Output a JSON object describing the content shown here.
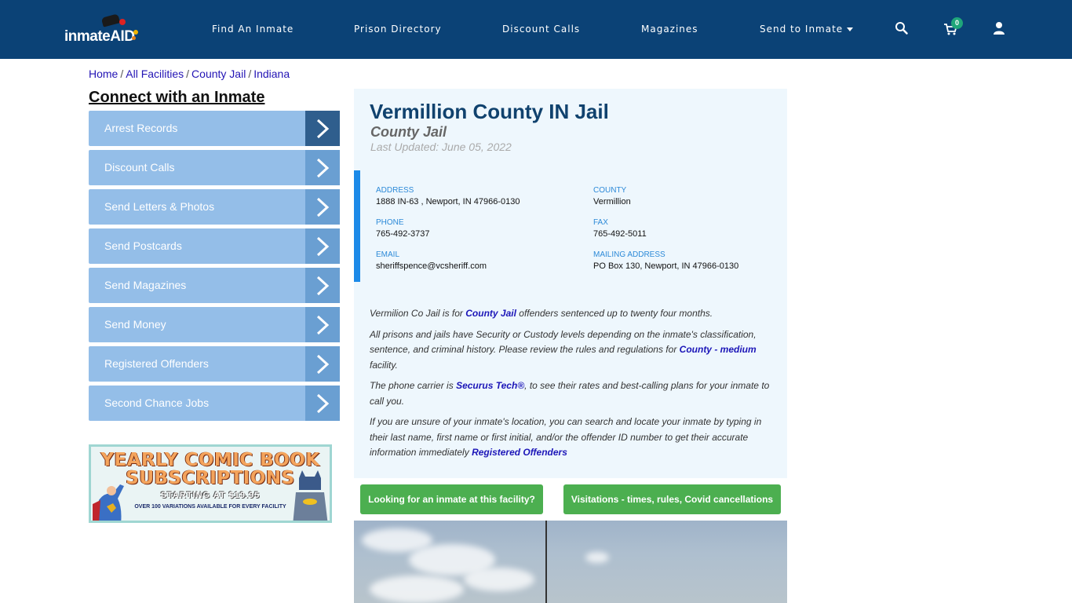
{
  "navbar": {
    "logo_text": "inmateAID",
    "links": [
      {
        "label": "Find An Inmate"
      },
      {
        "label": "Prison Directory"
      },
      {
        "label": "Discount Calls"
      },
      {
        "label": "Magazines"
      },
      {
        "label": "Send to Inmate",
        "has_dropdown": true
      }
    ],
    "icons": [
      "search-icon",
      "cart-icon",
      "user-icon"
    ],
    "cart_count": "0",
    "colors": {
      "background": "#0b4276",
      "badge": "#1fa67a"
    }
  },
  "breadcrumb": {
    "items": [
      "Home",
      "All Facilities",
      "County Jail",
      "Indiana"
    ],
    "separator": "/"
  },
  "sidebar": {
    "title": "Connect with an Inmate",
    "items": [
      {
        "label": "Arrest Records",
        "active": true
      },
      {
        "label": "Discount Calls"
      },
      {
        "label": "Send Letters & Photos"
      },
      {
        "label": "Send Postcards"
      },
      {
        "label": "Send Magazines"
      },
      {
        "label": "Send Money"
      },
      {
        "label": "Registered Offenders"
      },
      {
        "label": "Second Chance Jobs"
      }
    ],
    "ad": {
      "line1": "YEARLY COMIC BOOK",
      "line2": "SUBSCRIPTIONS",
      "line3": "STARTING AT $19.95",
      "line4": "OVER 100 VARIATIONS AVAILABLE FOR EVERY FACILITY"
    }
  },
  "facility": {
    "title": "Vermillion County IN Jail",
    "type": "County Jail",
    "last_updated": "Last Updated: June 05, 2022",
    "fields": {
      "address": {
        "label": "ADDRESS",
        "value": "1888 IN-63 , Newport, IN 47966-0130"
      },
      "county": {
        "label": "COUNTY",
        "value": "Vermillion"
      },
      "phone": {
        "label": "PHONE",
        "value": "765-492-3737"
      },
      "fax": {
        "label": "FAX",
        "value": "765-492-5011"
      },
      "email": {
        "label": "EMAIL",
        "value": "sheriffspence@vcsheriff.com"
      },
      "mailing": {
        "label": "MAILING ADDRESS",
        "value": "PO Box 130, Newport, IN 47966-0130"
      }
    },
    "description": {
      "p1_before": "Vermilion Co Jail is for ",
      "p1_link": "County Jail",
      "p1_after": " offenders sentenced up to twenty four months.",
      "p2_before": "All prisons and jails have Security or Custody levels depending on the inmate's classification, sentence, and criminal history. Please review the rules and regulations for ",
      "p2_link": "County - medium",
      "p2_after": " facility.",
      "p3_before": "The phone carrier is ",
      "p3_link": "Securus Tech®",
      "p3_after": ", to see their rates and best-calling plans for your inmate to call you.",
      "p4_before": "If you are unsure of your inmate's location, you can search and locate your inmate by typing in their last name, first name or first initial, and/or the offender ID number to get their accurate information immediately ",
      "p4_link": "Registered Offenders"
    },
    "buttons": {
      "find_inmate": "Looking for an inmate at this facility?",
      "visitations": "Visitations - times, rules, Covid cancellations"
    },
    "colors": {
      "title": "#10426e",
      "accent": "#1c8ae8",
      "button": "#4caf50",
      "panel": "#eef7fd"
    }
  }
}
